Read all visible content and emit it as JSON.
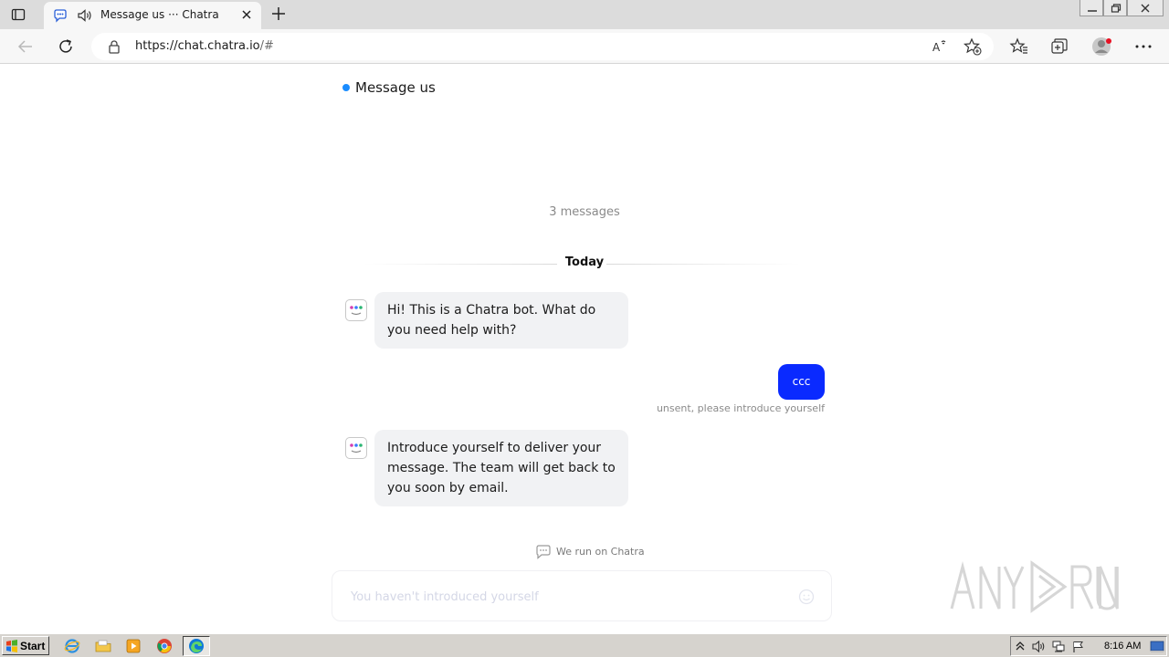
{
  "browser": {
    "tab_title": "Message us ··· Chatra",
    "url_host": "https://chat.chatra.io",
    "url_rest": "/#"
  },
  "chat": {
    "header_title": "Message us",
    "status_color": "#1a8cff",
    "message_count": "3 messages",
    "day_label": "Today",
    "messages": [
      {
        "from": "bot",
        "text": "Hi! This is a Chatra bot. What do you need help with?"
      },
      {
        "from": "user",
        "text": "ccc",
        "status": "unsent, please introduce yourself"
      },
      {
        "from": "bot",
        "text": "Introduce yourself to deliver your message. The team will get back to you soon by email."
      }
    ],
    "powered_by": "We run on Chatra",
    "composer_placeholder": "You haven't introduced yourself",
    "accent_color": "#0a2aff"
  },
  "taskbar": {
    "start_label": "Start",
    "clock": "8:16 AM"
  }
}
